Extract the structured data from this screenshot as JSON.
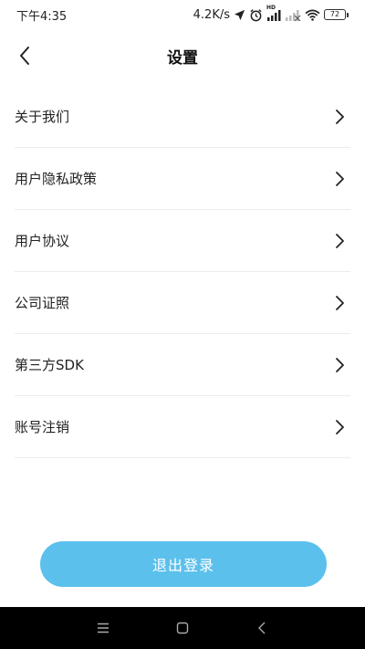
{
  "status_bar": {
    "time": "下午4:35",
    "network_speed": "4.2K/s",
    "network_type": "HD",
    "battery_level": "72",
    "icons": [
      "location-icon",
      "alarm-icon",
      "signal-icon",
      "no-signal-icon",
      "wifi-icon",
      "battery-icon"
    ]
  },
  "header": {
    "title": "设置",
    "back_icon": "chevron-left-icon"
  },
  "menu": {
    "items": [
      {
        "label": "关于我们"
      },
      {
        "label": "用户隐私政策"
      },
      {
        "label": "用户协议"
      },
      {
        "label": "公司证照"
      },
      {
        "label": "第三方SDK"
      },
      {
        "label": "账号注销"
      }
    ],
    "chevron_icon": "chevron-right-icon"
  },
  "logout": {
    "label": "退出登录",
    "color": "#5cc0ec"
  },
  "nav_bar": {
    "icons": [
      "menu-icon",
      "home-icon",
      "back-icon"
    ]
  }
}
